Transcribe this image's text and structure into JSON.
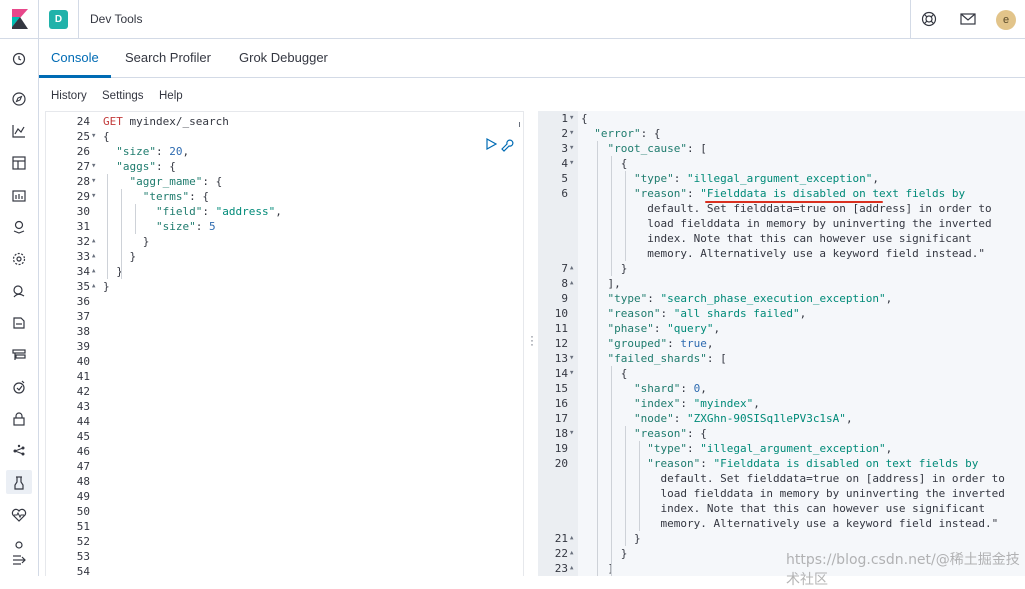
{
  "header": {
    "space_initial": "D",
    "app_title": "Dev Tools",
    "avatar_initial": "e"
  },
  "tabs": [
    "Console",
    "Search Profiler",
    "Grok Debugger"
  ],
  "menu": [
    "History",
    "Settings",
    "Help"
  ],
  "sidenav_icons": [
    "clock-icon",
    "discover-icon",
    "visualize-icon",
    "dashboard-icon",
    "canvas-icon",
    "maps-icon",
    "ml-icon",
    "graph-icon",
    "apm-icon",
    "infrastructure-icon",
    "uptime-icon",
    "siem-icon",
    "security-icon",
    "stack-monitoring-icon",
    "dev-tools-icon",
    "heartbeat-icon",
    "management-icon",
    "collapse-icon"
  ],
  "editor": {
    "lines": [
      {
        "n": "24",
        "fold": "",
        "text": "GET myindex/_search"
      },
      {
        "n": "25",
        "fold": "▾",
        "text": "{"
      },
      {
        "n": "26",
        "fold": "",
        "text": "  \"size\": 20,"
      },
      {
        "n": "27",
        "fold": "▾",
        "text": "  \"aggs\": {"
      },
      {
        "n": "28",
        "fold": "▾",
        "text": "    \"aggr_mame\": {"
      },
      {
        "n": "29",
        "fold": "▾",
        "text": "      \"terms\": {"
      },
      {
        "n": "30",
        "fold": "",
        "text": "        \"field\": \"address\","
      },
      {
        "n": "31",
        "fold": "",
        "text": "        \"size\": 5"
      },
      {
        "n": "32",
        "fold": "▴",
        "text": "      }"
      },
      {
        "n": "33",
        "fold": "▴",
        "text": "    }"
      },
      {
        "n": "34",
        "fold": "▴",
        "text": "  }"
      },
      {
        "n": "35",
        "fold": "▴",
        "text": "}"
      },
      {
        "n": "36",
        "fold": "",
        "text": ""
      },
      {
        "n": "37",
        "fold": "",
        "text": ""
      },
      {
        "n": "38",
        "fold": "",
        "text": ""
      },
      {
        "n": "39",
        "fold": "",
        "text": ""
      },
      {
        "n": "40",
        "fold": "",
        "text": ""
      },
      {
        "n": "41",
        "fold": "",
        "text": ""
      },
      {
        "n": "42",
        "fold": "",
        "text": ""
      },
      {
        "n": "43",
        "fold": "",
        "text": ""
      },
      {
        "n": "44",
        "fold": "",
        "text": ""
      },
      {
        "n": "45",
        "fold": "",
        "text": ""
      },
      {
        "n": "46",
        "fold": "",
        "text": ""
      },
      {
        "n": "47",
        "fold": "",
        "text": ""
      },
      {
        "n": "48",
        "fold": "",
        "text": ""
      },
      {
        "n": "49",
        "fold": "",
        "text": ""
      },
      {
        "n": "50",
        "fold": "",
        "text": ""
      },
      {
        "n": "51",
        "fold": "",
        "text": ""
      },
      {
        "n": "52",
        "fold": "",
        "text": ""
      },
      {
        "n": "53",
        "fold": "",
        "text": ""
      },
      {
        "n": "54",
        "fold": "",
        "text": ""
      }
    ]
  },
  "output": {
    "lines": [
      {
        "n": "1",
        "fold": "▾",
        "text": "{"
      },
      {
        "n": "2",
        "fold": "▾",
        "text": "  \"error\": {"
      },
      {
        "n": "3",
        "fold": "▾",
        "text": "    \"root_cause\": ["
      },
      {
        "n": "4",
        "fold": "▾",
        "text": "      {"
      },
      {
        "n": "5",
        "fold": "",
        "text": "        \"type\": \"illegal_argument_exception\","
      },
      {
        "n": "6",
        "fold": "",
        "text": "        \"reason\": \"Fielddata is disabled on text fields by"
      },
      {
        "n": "",
        "fold": "",
        "text": "          default. Set fielddata=true on [address] in order to"
      },
      {
        "n": "",
        "fold": "",
        "text": "          load fielddata in memory by uninverting the inverted"
      },
      {
        "n": "",
        "fold": "",
        "text": "          index. Note that this can however use significant"
      },
      {
        "n": "",
        "fold": "",
        "text": "          memory. Alternatively use a keyword field instead.\""
      },
      {
        "n": "7",
        "fold": "▴",
        "text": "      }"
      },
      {
        "n": "8",
        "fold": "▴",
        "text": "    ],"
      },
      {
        "n": "9",
        "fold": "",
        "text": "    \"type\": \"search_phase_execution_exception\","
      },
      {
        "n": "10",
        "fold": "",
        "text": "    \"reason\": \"all shards failed\","
      },
      {
        "n": "11",
        "fold": "",
        "text": "    \"phase\": \"query\","
      },
      {
        "n": "12",
        "fold": "",
        "text": "    \"grouped\": true,"
      },
      {
        "n": "13",
        "fold": "▾",
        "text": "    \"failed_shards\": ["
      },
      {
        "n": "14",
        "fold": "▾",
        "text": "      {"
      },
      {
        "n": "15",
        "fold": "",
        "text": "        \"shard\": 0,"
      },
      {
        "n": "16",
        "fold": "",
        "text": "        \"index\": \"myindex\","
      },
      {
        "n": "17",
        "fold": "",
        "text": "        \"node\": \"ZXGhn-90SISq1lePV3c1sA\","
      },
      {
        "n": "18",
        "fold": "▾",
        "text": "        \"reason\": {"
      },
      {
        "n": "19",
        "fold": "",
        "text": "          \"type\": \"illegal_argument_exception\","
      },
      {
        "n": "20",
        "fold": "",
        "text": "          \"reason\": \"Fielddata is disabled on text fields by"
      },
      {
        "n": "",
        "fold": "",
        "text": "            default. Set fielddata=true on [address] in order to"
      },
      {
        "n": "",
        "fold": "",
        "text": "            load fielddata in memory by uninverting the inverted"
      },
      {
        "n": "",
        "fold": "",
        "text": "            index. Note that this can however use significant"
      },
      {
        "n": "",
        "fold": "",
        "text": "            memory. Alternatively use a keyword field instead.\""
      },
      {
        "n": "21",
        "fold": "▴",
        "text": "        }"
      },
      {
        "n": "22",
        "fold": "▴",
        "text": "      }"
      },
      {
        "n": "23",
        "fold": "▴",
        "text": "    ]"
      }
    ]
  },
  "watermark": "https://blog.csdn.net/@稀土掘金技术社区"
}
